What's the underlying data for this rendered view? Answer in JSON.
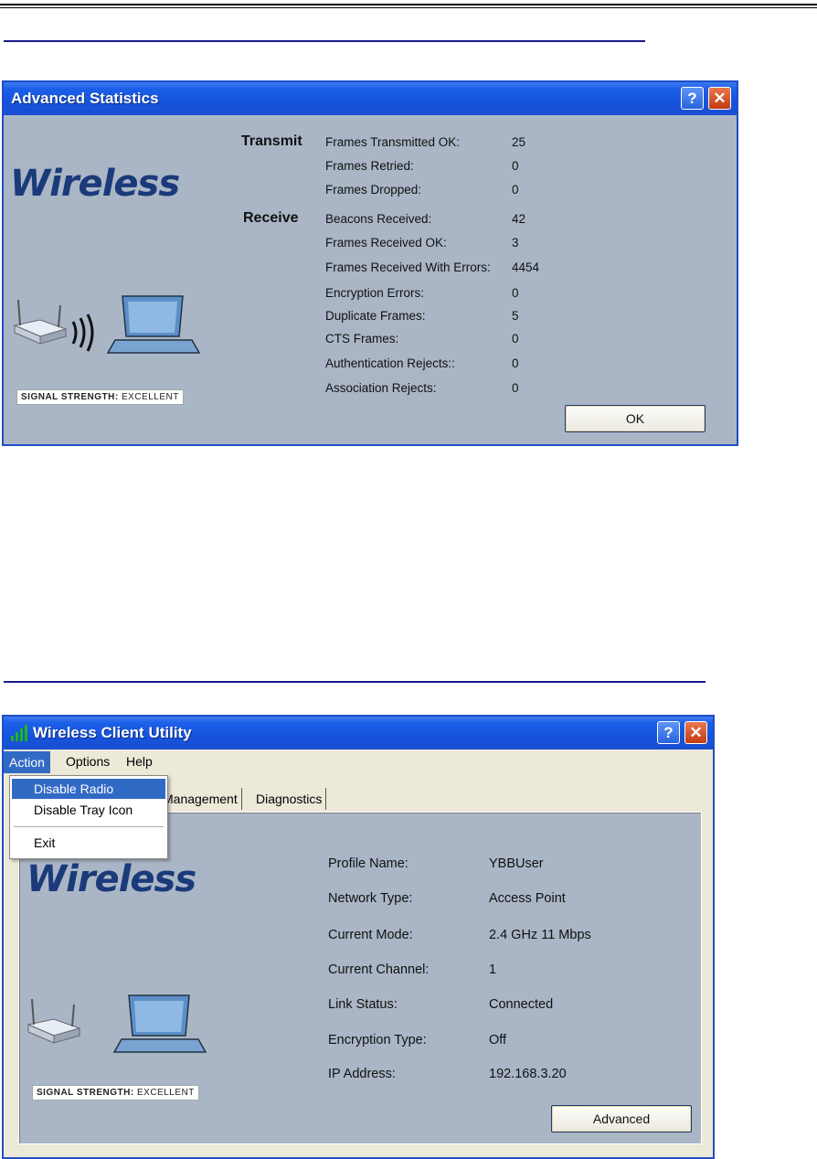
{
  "stats_window": {
    "title": "Advanced Statistics",
    "logo": "Wireless",
    "signal_label": "SIGNAL STRENGTH:",
    "signal_value": "EXCELLENT",
    "transmit_header": "Transmit",
    "receive_header": "Receive",
    "rows": [
      {
        "label": "Frames Transmitted OK:",
        "value": "25"
      },
      {
        "label": "Frames Retried:",
        "value": "0"
      },
      {
        "label": "Frames Dropped:",
        "value": "0"
      },
      {
        "label": "Beacons Received:",
        "value": "42"
      },
      {
        "label": "Frames Received OK:",
        "value": "3"
      },
      {
        "label": "Frames Received With Errors:",
        "value": "4454"
      },
      {
        "label": "Encryption Errors:",
        "value": "0"
      },
      {
        "label": "Duplicate Frames:",
        "value": "5"
      },
      {
        "label": "CTS Frames:",
        "value": "0"
      },
      {
        "label": "Authentication Rejects::",
        "value": "0"
      },
      {
        "label": "Association Rejects:",
        "value": "0"
      }
    ],
    "ok_button": "OK",
    "help_glyph": "?",
    "close_glyph": "✕"
  },
  "client_window": {
    "title": "Wireless Client Utility",
    "menu": {
      "action": "Action",
      "options": "Options",
      "help": "Help"
    },
    "dropdown": {
      "disable_radio": "Disable Radio",
      "disable_tray": "Disable Tray Icon",
      "exit": "Exit"
    },
    "tabs": {
      "management": "Management",
      "diagnostics": "Diagnostics"
    },
    "logo": "Wireless",
    "signal_label": "SIGNAL STRENGTH:",
    "signal_value": "EXCELLENT",
    "rows": [
      {
        "label": "Profile Name:",
        "value": "YBBUser"
      },
      {
        "label": "Network Type:",
        "value": "Access Point"
      },
      {
        "label": "Current Mode:",
        "value": "2.4 GHz 11 Mbps"
      },
      {
        "label": "Current Channel:",
        "value": "1"
      },
      {
        "label": "Link Status:",
        "value": "Connected"
      },
      {
        "label": "Encryption Type:",
        "value": "Off"
      },
      {
        "label": "IP Address:",
        "value": "192.168.3.20"
      }
    ],
    "advanced_button": "Advanced",
    "help_glyph": "?",
    "close_glyph": "✕"
  }
}
